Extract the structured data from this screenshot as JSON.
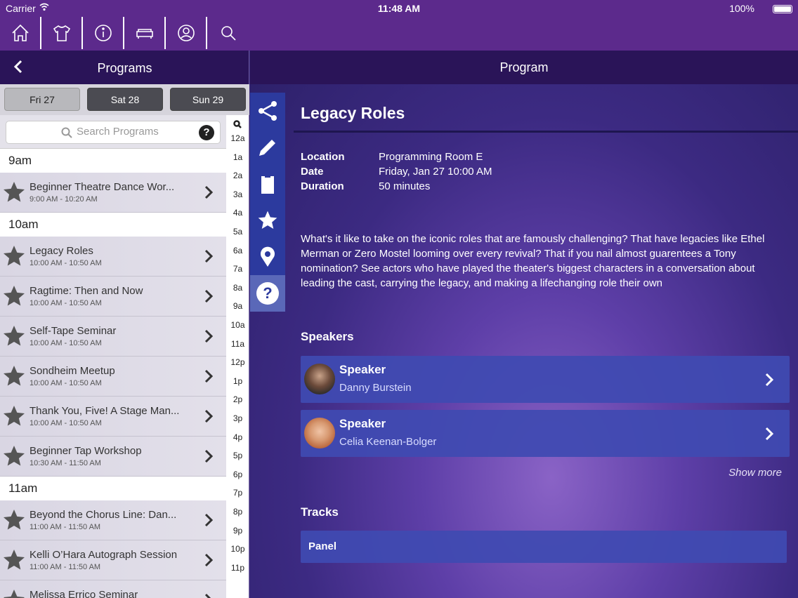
{
  "status": {
    "carrier": "Carrier",
    "time": "11:48 AM",
    "battery": "100%"
  },
  "nav": {
    "icons": [
      "home-icon",
      "tshirt-icon",
      "info-icon",
      "sofa-icon",
      "profile-icon",
      "search-icon"
    ]
  },
  "left": {
    "header": {
      "title": "Programs"
    },
    "days": [
      {
        "label": "Fri 27",
        "active": true
      },
      {
        "label": "Sat 28",
        "active": false
      },
      {
        "label": "Sun 29",
        "active": false
      }
    ],
    "search": {
      "placeholder": "Search Programs",
      "help": "?"
    },
    "groups": [
      {
        "time": "9am",
        "items": [
          {
            "title": "Beginner Theatre Dance Wor...",
            "time": "9:00 AM - 10:20 AM"
          }
        ]
      },
      {
        "time": "10am",
        "items": [
          {
            "title": "Legacy Roles",
            "time": "10:00 AM - 10:50 AM"
          },
          {
            "title": "Ragtime: Then and Now",
            "time": "10:00 AM - 10:50 AM"
          },
          {
            "title": "Self-Tape Seminar",
            "time": "10:00 AM - 10:50 AM"
          },
          {
            "title": "Sondheim Meetup",
            "time": "10:00 AM - 10:50 AM"
          },
          {
            "title": "Thank You, Five! A Stage Man...",
            "time": "10:00 AM - 10:50 AM"
          },
          {
            "title": "Beginner Tap Workshop",
            "time": "10:30 AM - 11:50 AM"
          }
        ]
      },
      {
        "time": "11am",
        "items": [
          {
            "title": "Beyond the Chorus Line: Dan...",
            "time": "11:00 AM - 11:50 AM"
          },
          {
            "title": "Kelli O’Hara Autograph Session",
            "time": "11:00 AM - 11:50 AM"
          },
          {
            "title": "Melissa Errico Seminar",
            "time": ""
          }
        ]
      }
    ],
    "hours": [
      "12a",
      "1a",
      "2a",
      "3a",
      "4a",
      "5a",
      "6a",
      "7a",
      "8a",
      "9a",
      "10a",
      "11a",
      "12p",
      "1p",
      "2p",
      "3p",
      "4p",
      "5p",
      "6p",
      "7p",
      "8p",
      "9p",
      "10p",
      "11p"
    ]
  },
  "right": {
    "header": {
      "title": "Program"
    },
    "toolbar": [
      "share-icon",
      "edit-icon",
      "clipboard-icon",
      "star-icon",
      "location-icon",
      "help-icon"
    ],
    "title": "Legacy Roles",
    "details": [
      {
        "key": "Location",
        "value": "Programming Room E"
      },
      {
        "key": "Date",
        "value": "Friday, Jan 27 10:00 AM"
      },
      {
        "key": "Duration",
        "value": "50 minutes"
      }
    ],
    "description": "What's it like to take on the iconic roles that are famously challenging? That have legacies like Ethel Merman or Zero Mostel looming over every revival? That if you nail almost guarentees a Tony nomination? See actors who have played the theater's biggest characters in a conversation about leading the cast, carrying the legacy, and making a lifechanging role their own",
    "speakers_heading": "Speakers",
    "speakers": [
      {
        "role": "Speaker",
        "name": "Danny Burstein"
      },
      {
        "role": "Speaker",
        "name": "Celia Keenan-Bolger"
      }
    ],
    "show_more": "Show more",
    "tracks_heading": "Tracks",
    "tracks": [
      "Panel"
    ]
  },
  "colors": {
    "topbar": "#5c2a8c",
    "header": "#2a1458",
    "toolbar": "#2c3a9e",
    "card": "#404ab2"
  }
}
